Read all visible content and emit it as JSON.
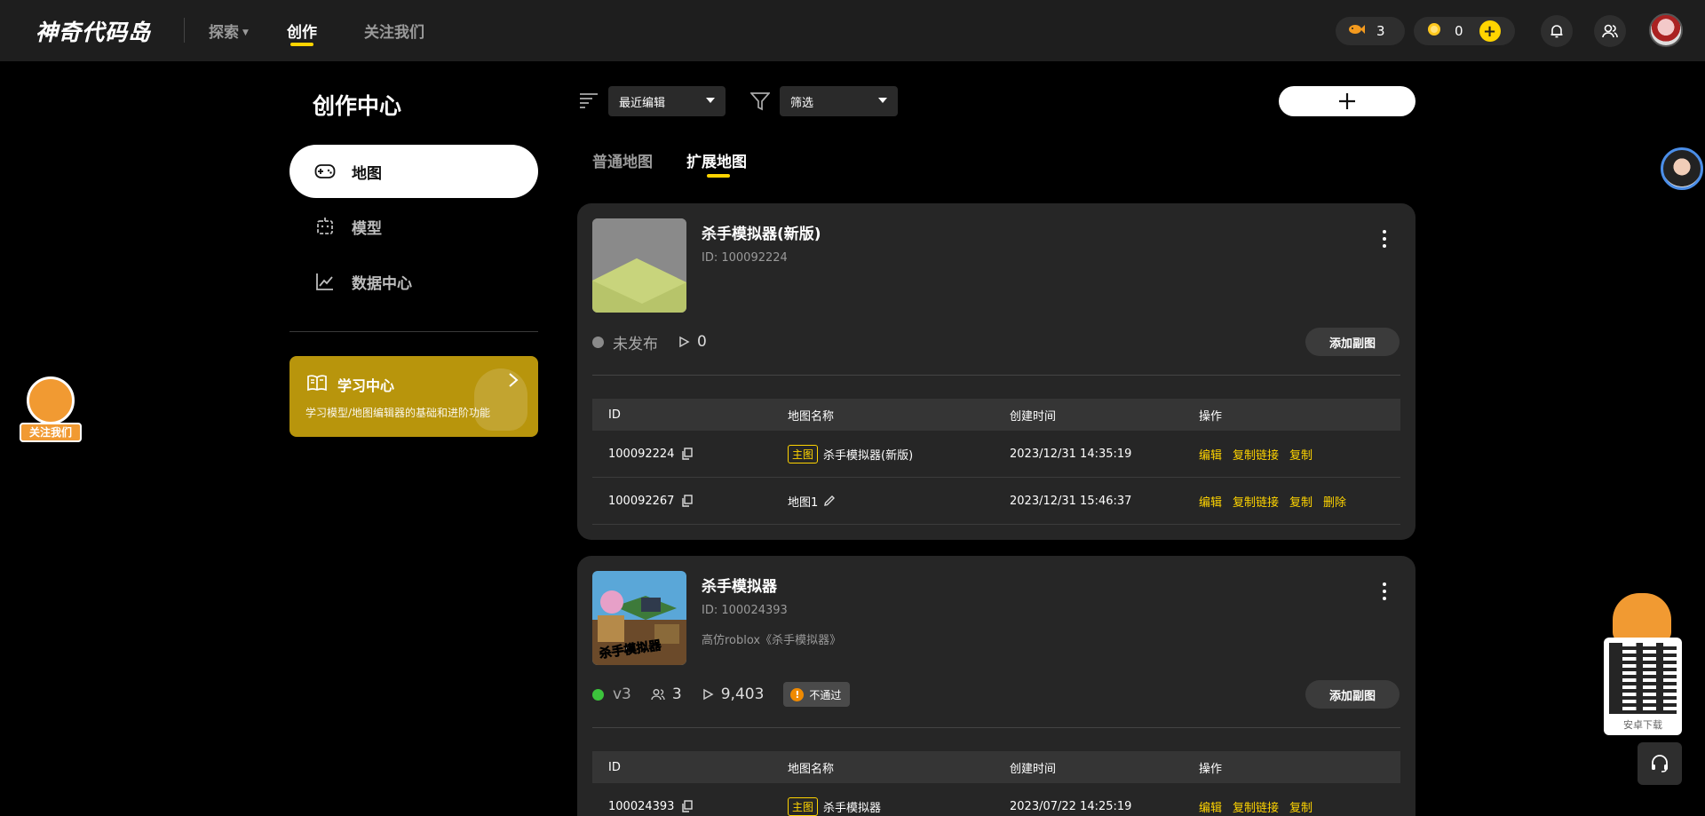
{
  "header": {
    "logo_text": "神奇代码岛",
    "nav": [
      {
        "label": "探索"
      },
      {
        "label": "创作"
      },
      {
        "label": "关注我们"
      }
    ],
    "fish_count": "3",
    "coin_count": "0"
  },
  "sidebar": {
    "title": "创作中心",
    "items": [
      {
        "label": "地图"
      },
      {
        "label": "模型"
      },
      {
        "label": "数据中心"
      }
    ],
    "learn": {
      "title": "学习中心",
      "subtitle": "学习模型/地图编辑器的基础和进阶功能"
    }
  },
  "toolbar": {
    "sort_value": "最近编辑",
    "filter_value": "筛选"
  },
  "tabs": [
    {
      "label": "普通地图"
    },
    {
      "label": "扩展地图"
    }
  ],
  "table_headers": {
    "id": "ID",
    "name": "地图名称",
    "created": "创建时间",
    "ops": "操作"
  },
  "ops": {
    "edit": "编辑",
    "copy_link": "复制链接",
    "copy": "复制",
    "delete": "删除"
  },
  "main_tag": "主图",
  "add_sub_map": "添加副图",
  "cards": [
    {
      "title": "杀手模拟器(新版)",
      "id": "ID: 100092224",
      "status": "未发布",
      "plays": "0",
      "rows": [
        {
          "id": "100092224",
          "is_main": true,
          "name": "杀手模拟器(新版)",
          "created": "2023/12/31 14:35:19"
        },
        {
          "id": "100092267",
          "is_main": false,
          "name": "地图1",
          "created": "2023/12/31 15:46:37"
        }
      ]
    },
    {
      "title": "杀手模拟器",
      "id": "ID: 100024393",
      "desc": "高仿roblox《杀手模拟器》",
      "version": "v3",
      "players": "3",
      "plays": "9,403",
      "review": "不通过",
      "thumb_caption": "杀手模拟器",
      "rows": [
        {
          "id": "100024393",
          "is_main": true,
          "name": "杀手模拟器",
          "created": "2023/07/22 14:25:19"
        }
      ]
    }
  ],
  "floating": {
    "follow_label": "关注我们",
    "android_download": "安卓下载"
  },
  "colors": {
    "accent": "#ffd400",
    "card_bg": "#262626",
    "topbar_bg": "#1e1e1e",
    "learn_bg": "#b8950c",
    "online": "#3cc43c",
    "offline": "#8a8a8a"
  }
}
